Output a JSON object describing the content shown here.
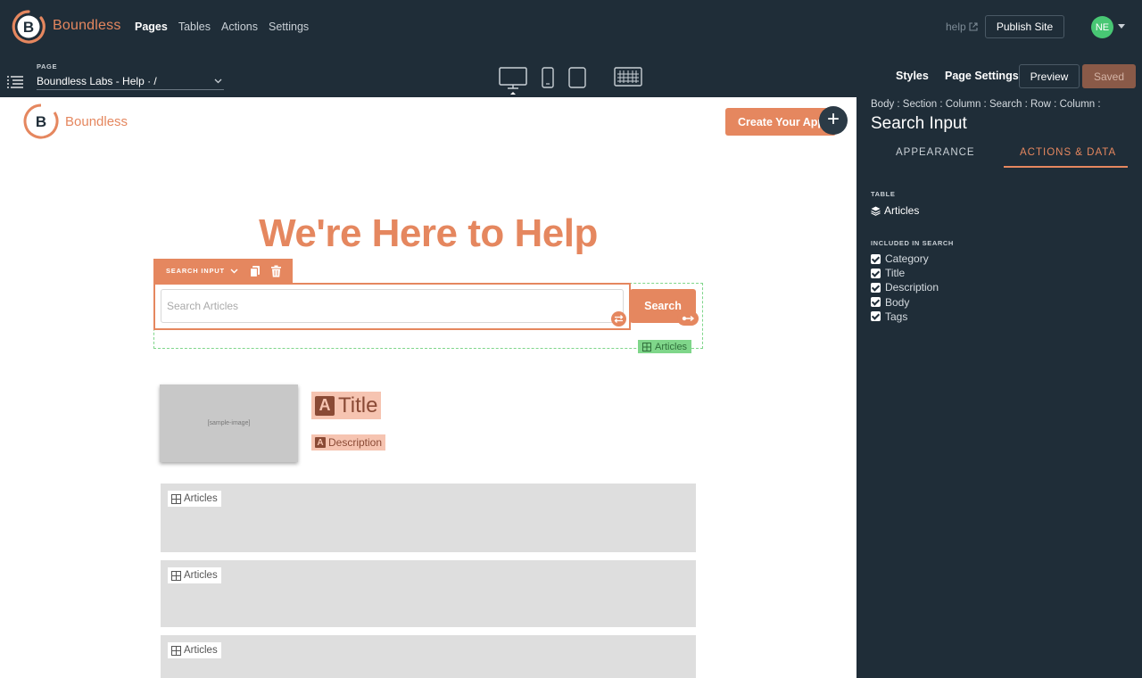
{
  "colors": {
    "brand": "#e5875f",
    "dark": "#1f2d38",
    "success": "#48c774"
  },
  "app": {
    "brand_name": "Boundless",
    "nav": [
      {
        "label": "Pages",
        "active": true
      },
      {
        "label": "Tables",
        "active": false
      },
      {
        "label": "Actions",
        "active": false
      },
      {
        "label": "Settings",
        "active": false
      }
    ],
    "help_label": "help",
    "publish_label": "Publish Site",
    "avatar_initials": "NE"
  },
  "toolbar": {
    "page_label": "PAGE",
    "page_value": "Boundless Labs - Help · /",
    "styles_label": "Styles",
    "page_settings_label": "Page Settings",
    "preview_label": "Preview",
    "saved_label": "Saved"
  },
  "canvas": {
    "brand_name": "Boundless",
    "cta_label": "Create Your App",
    "hero_title": "We're Here to Help",
    "search_input_toolbar_label": "SEARCH INPUT",
    "search_placeholder": "Search Articles",
    "search_button_label": "Search",
    "search_table_tag": "Articles",
    "sample_image_label": "[sample-image]",
    "title_chip": "Title",
    "description_chip": "Description",
    "list_items": [
      {
        "label": "Articles"
      },
      {
        "label": "Articles"
      },
      {
        "label": "Articles"
      }
    ]
  },
  "panel": {
    "breadcrumb": "Body : Section : Column : Search : Row : Column :",
    "title": "Search Input",
    "tabs": [
      {
        "label": "APPEARANCE",
        "active": false
      },
      {
        "label": "ACTIONS & DATA",
        "active": true
      }
    ],
    "table_label": "TABLE",
    "table_value": "Articles",
    "included_label": "INCLUDED IN SEARCH",
    "included_fields": [
      "Category",
      "Title",
      "Description",
      "Body",
      "Tags"
    ]
  }
}
